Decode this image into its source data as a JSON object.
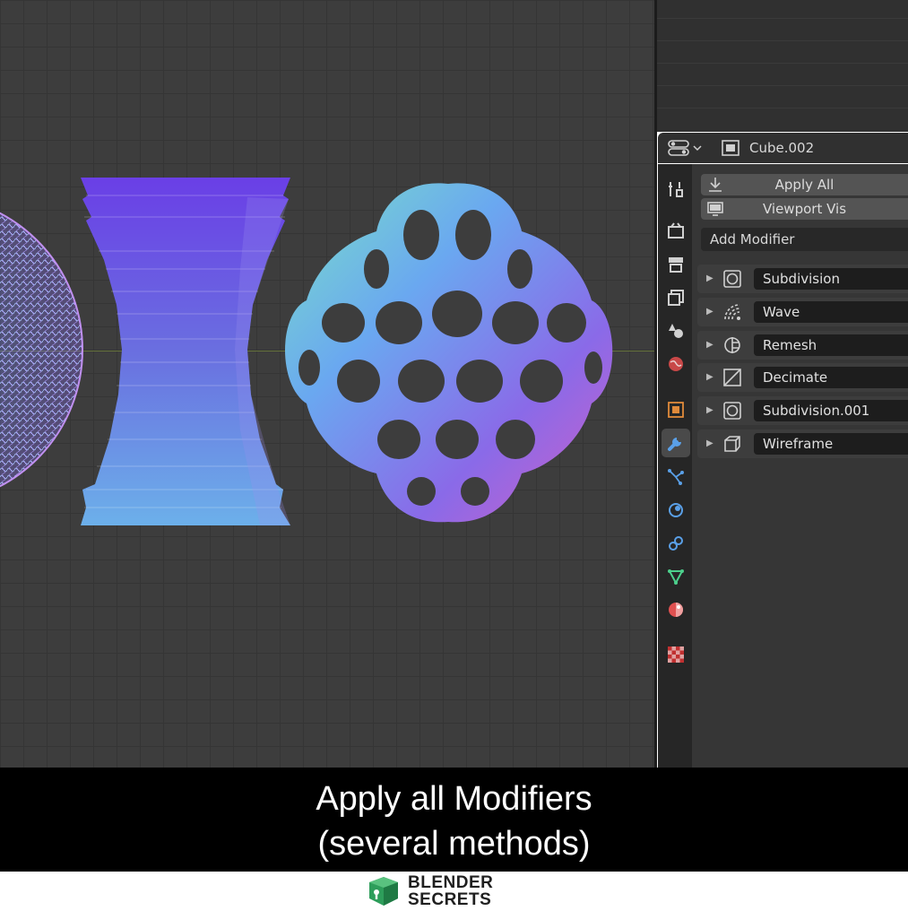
{
  "properties_editor": {
    "object_name": "Cube.002",
    "apply_all_label": "Apply All",
    "viewport_vis_label": "Viewport Vis",
    "add_modifier_label": "Add Modifier",
    "modifiers": [
      {
        "name": "Subdivision",
        "icon": "subdivision-icon"
      },
      {
        "name": "Wave",
        "icon": "wave-icon"
      },
      {
        "name": "Remesh",
        "icon": "remesh-icon"
      },
      {
        "name": "Decimate",
        "icon": "decimate-icon"
      },
      {
        "name": "Subdivision.001",
        "icon": "subdivision-icon"
      },
      {
        "name": "Wireframe",
        "icon": "wireframe-icon"
      }
    ],
    "tabs": [
      "tool-icon",
      "render-icon",
      "output-icon",
      "view-layer-icon",
      "scene-icon",
      "world-icon",
      "object-icon",
      "modifier-icon",
      "particles-icon",
      "physics-icon",
      "constraints-icon",
      "data-icon",
      "material-icon",
      "texture-icon"
    ],
    "active_tab": "modifier-icon"
  },
  "caption": {
    "line1": "Apply all Modifiers",
    "line2": "(several methods)"
  },
  "logo": {
    "line1": "BLENDER",
    "line2": "SECRETS"
  },
  "colors": {
    "viewport_bg": "#3d3d3d",
    "accent_active_tab": "#4a4a4a",
    "logo_green": "#2e9e5b"
  }
}
